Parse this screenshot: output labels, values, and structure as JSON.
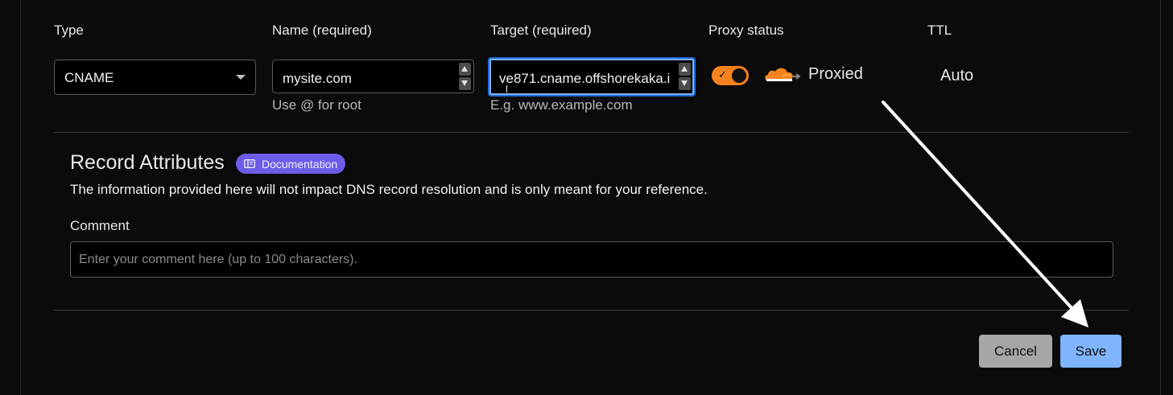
{
  "columns": {
    "type": "Type",
    "name": "Name (required)",
    "target": "Target (required)",
    "proxy": "Proxy status",
    "ttl": "TTL"
  },
  "fields": {
    "type_value": "CNAME",
    "name_value": "mysite.com",
    "name_hint": "Use @ for root",
    "target_value": "ve871.cname.offshorekaka.i",
    "target_hint": "E.g. www.example.com",
    "proxy_status": "Proxied",
    "proxy_enabled": true,
    "ttl_value": "Auto"
  },
  "record_attributes": {
    "title": "Record Attributes",
    "doc_badge": "Documentation",
    "description": "The information provided here will not impact DNS record resolution and is only meant for your reference.",
    "comment_label": "Comment",
    "comment_placeholder": "Enter your comment here (up to 100 characters).",
    "comment_value": ""
  },
  "actions": {
    "cancel": "Cancel",
    "save": "Save"
  },
  "colors": {
    "accent_orange": "#f6821f",
    "badge_purple": "#6c5ce7",
    "save_blue": "#7fb5ff",
    "focus_blue": "#1d6bd8"
  },
  "icons": {
    "type_dropdown": "chevron-down-icon",
    "proxy_toggle_check": "check-icon",
    "proxy_cloud": "cloudflare-cloud-icon",
    "doc_badge": "book-icon",
    "annotation": "arrow-pointer-icon"
  }
}
